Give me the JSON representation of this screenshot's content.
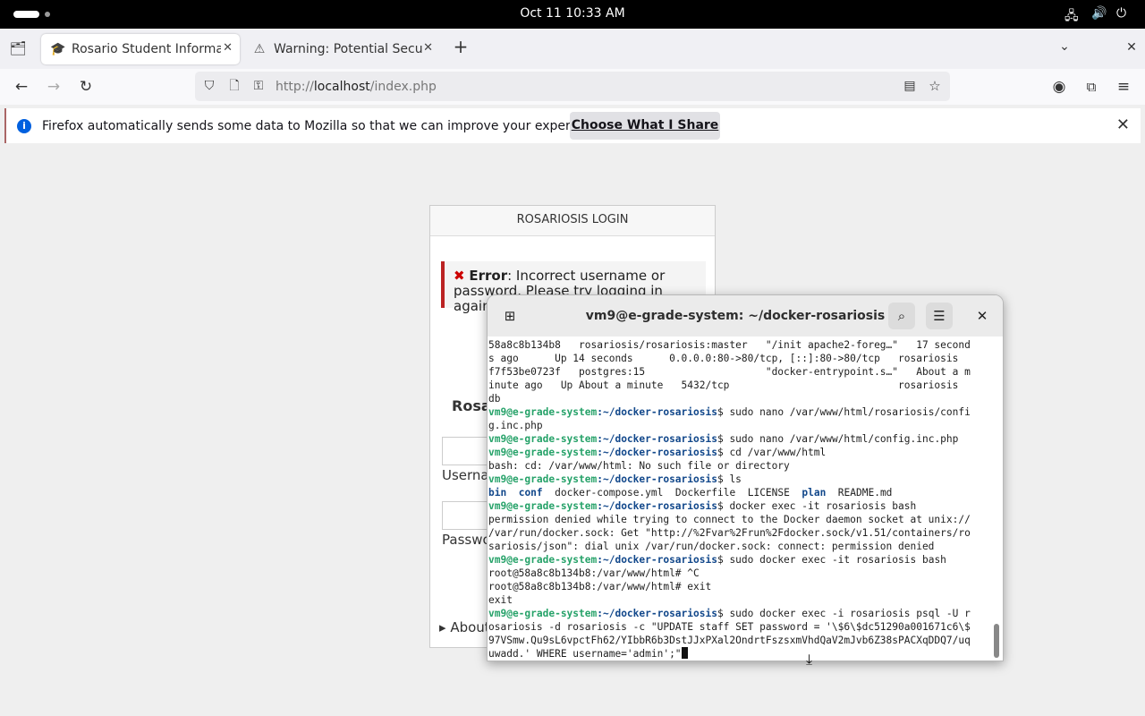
{
  "topbar": {
    "clock": "Oct 11  10:33 AM"
  },
  "tabs": [
    {
      "label": "Rosario Student Informati",
      "icon": "graduation-cap-icon",
      "active": true
    },
    {
      "label": "Warning: Potential Securi",
      "icon": "warning-icon",
      "active": false
    }
  ],
  "nav": {
    "url_scheme": "http://",
    "url_host": "localhost",
    "url_path": "/index.php"
  },
  "notification": {
    "text": "Firefox automatically sends some data to Mozilla so that we can improve your experience.",
    "button": "Choose What I Share"
  },
  "login": {
    "header": "ROSARIOSIS LOGIN",
    "error_label": "Error",
    "error_text": ": Incorrect username or password. Please try logging in again.",
    "site_name": "Rosar",
    "username_label": "Userna",
    "password_label": "Passwo",
    "about_label": "About"
  },
  "terminal": {
    "title": "vm9@e-grade-system: ~/docker-rosariosis",
    "prompt_user": "vm9@e-grade-system",
    "prompt_path": ":~/docker-rosariosis",
    "lines": [
      {
        "t": "out",
        "text": "58a8c8b134b8   rosariosis/rosariosis:master   \"/init apache2-foreg…\"   17 second"
      },
      {
        "t": "out",
        "text": "s ago      Up 14 seconds      0.0.0.0:80->80/tcp, [::]:80->80/tcp   rosariosis"
      },
      {
        "t": "out",
        "text": "f7f53be0723f   postgres:15                    \"docker-entrypoint.s…\"   About a m"
      },
      {
        "t": "out",
        "text": "inute ago   Up About a minute   5432/tcp                            rosariosis"
      },
      {
        "t": "out",
        "text": "db"
      },
      {
        "t": "cmd",
        "text": "$ sudo nano /var/www/html/rosariosis/confi"
      },
      {
        "t": "out",
        "text": "g.inc.php"
      },
      {
        "t": "cmd",
        "text": "$ sudo nano /var/www/html/config.inc.php"
      },
      {
        "t": "cmd",
        "text": "$ cd /var/www/html"
      },
      {
        "t": "out",
        "text": "bash: cd: /var/www/html: No such file or directory"
      },
      {
        "t": "cmd",
        "text": "$ ls"
      },
      {
        "t": "ls"
      },
      {
        "t": "cmd",
        "text": "$ docker exec -it rosariosis bash"
      },
      {
        "t": "out",
        "text": "permission denied while trying to connect to the Docker daemon socket at unix://"
      },
      {
        "t": "out",
        "text": "/var/run/docker.sock: Get \"http://%2Fvar%2Frun%2Fdocker.sock/v1.51/containers/ro"
      },
      {
        "t": "out",
        "text": "sariosis/json\": dial unix /var/run/docker.sock: connect: permission denied"
      },
      {
        "t": "cmd",
        "text": "$ sudo docker exec -it rosariosis bash"
      },
      {
        "t": "out",
        "text": "root@58a8c8b134b8:/var/www/html# ^C"
      },
      {
        "t": "out",
        "text": "root@58a8c8b134b8:/var/www/html# exit"
      },
      {
        "t": "out",
        "text": "exit"
      },
      {
        "t": "cmd",
        "text": "$ sudo docker exec -i rosariosis psql -U r"
      },
      {
        "t": "out",
        "text": "osariosis -d rosariosis -c \"UPDATE staff SET password = '\\$6\\$dc51290a001671c6\\$"
      },
      {
        "t": "out",
        "text": "97VSmw.Qu9sL6vpctFh62/YIbbR6b3DstJJxPXal2OndrtFszsxmVhdQaV2mJvb6Z38sPACXqDDQ7/uq"
      },
      {
        "t": "last",
        "text": "uwadd.' WHERE username='admin';\""
      }
    ],
    "ls_items": [
      {
        "text": "bin",
        "dir": true
      },
      {
        "text": "conf",
        "dir": true
      },
      {
        "text": "docker-compose.yml",
        "dir": false
      },
      {
        "text": "Dockerfile",
        "dir": false
      },
      {
        "text": "LICENSE",
        "dir": false
      },
      {
        "text": "plan",
        "dir": true
      },
      {
        "text": "README.md",
        "dir": false
      }
    ]
  }
}
